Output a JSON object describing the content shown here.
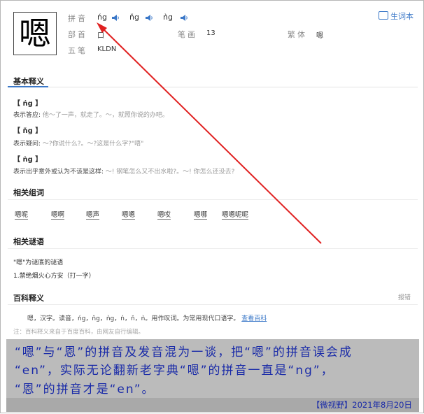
{
  "header": {
    "character": "嗯",
    "pinyin_label": "拼音",
    "pinyin": [
      "ńg",
      "ňg",
      "ǹg"
    ],
    "radical_label": "部首",
    "radical": "口",
    "strokes_label": "笔画",
    "strokes": "13",
    "traditional_label": "繁体",
    "traditional": "嗯",
    "wubi_label": "五笔",
    "wubi": "KLDN",
    "vocab_label": "生词本"
  },
  "basic": {
    "title": "基本释义",
    "entries": [
      {
        "pinyin": "【 ńg 】",
        "def": "表示答应:",
        "ex": "他～了一声，就走了。～，就照你说的办吧。"
      },
      {
        "pinyin": "【 ňg 】",
        "def": "表示疑问:",
        "ex": "～?你说什么?。～?这是什么字?\"唔\""
      },
      {
        "pinyin": "【 ǹg 】",
        "def": "表示出乎意外或认为不该是这样:",
        "ex": "～! 钢笔怎么又不出水啦?。～! 你怎么还没去?"
      }
    ]
  },
  "words": {
    "title": "相关组词",
    "items": [
      "嗯呢",
      "嗯啊",
      "嗯声",
      "嗯嗯",
      "嗯哎",
      "嗯哪",
      "嗯嗯呢呢"
    ]
  },
  "riddle": {
    "title": "相关谜语",
    "line1": "\"嗯\"为谜底的谜语",
    "line2": "1.禁绝烟火心方安（打一字）"
  },
  "baike": {
    "title": "百科释义",
    "report": "报错",
    "text": "嗯，汉字。读音，ńg，ňg，ǹg，ń，ň，ǹ。用作叹词。为常用现代口语字。",
    "link": "查看百科",
    "note": "注：百科释义来自于百度百科，由网友自行编辑。"
  },
  "caption": {
    "line1": "“嗯”与“恩”的拼音及发音混为一谈，把“嗯”的拼音误会成",
    "line2": "“en”，实际无论翻新老字典“嗯”的拼音一直是“ng”，",
    "line3": "“恩”的拼音才是“en”。",
    "footer": "【微视野】2021年8月20日"
  },
  "colors": {
    "accent": "#3b78c8",
    "arrow": "#e02020",
    "caption_text": "#1a2ba8"
  }
}
